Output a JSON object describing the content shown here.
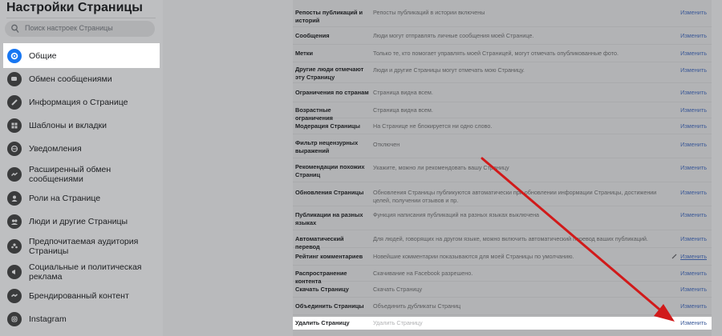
{
  "sidebar": {
    "title": "Настройки Страницы",
    "search_placeholder": "Поиск настроек Страницы",
    "items": [
      {
        "label": "Общие",
        "icon": "gear-icon"
      },
      {
        "label": "Обмен сообщениями",
        "icon": "chat-bubble-icon"
      },
      {
        "label": "Информация о Странице",
        "icon": "pencil-icon"
      },
      {
        "label": "Шаблоны и вкладки",
        "icon": "grid-icon"
      },
      {
        "label": "Уведомления",
        "icon": "globe-icon"
      },
      {
        "label": "Расширенный обмен сообщениями",
        "icon": "messenger-icon"
      },
      {
        "label": "Роли на Странице",
        "icon": "person-icon"
      },
      {
        "label": "Люди и другие Страницы",
        "icon": "people-icon"
      },
      {
        "label": "Предпочитаемая аудитория Страницы",
        "icon": "audience-icon"
      },
      {
        "label": "Социальные и политическая реклама",
        "icon": "megaphone-icon"
      },
      {
        "label": "Брендированный контент",
        "icon": "handshake-icon"
      },
      {
        "label": "Instagram",
        "icon": "instagram-icon"
      }
    ]
  },
  "settings": {
    "rows": [
      {
        "name": "Репосты публикаций и историй",
        "desc": "Репосты публикаций в истории включены",
        "edit": "Изменить"
      },
      {
        "name": "Сообщения",
        "desc": "Люди могут отправлять личные сообщения моей Странице.",
        "edit": "Изменить"
      },
      {
        "name": "Метки",
        "desc": "Только те, кто помогает управлять моей Страницей, могут отмечать опубликованные фото.",
        "edit": "Изменить"
      },
      {
        "name": "Другие люди отмечают эту Страницу",
        "desc": "Люди и другие Страницы могут отмечать мою Страницу.",
        "edit": "Изменить"
      },
      {
        "name": "Ограничения по странам",
        "desc": "Страница видна всем.",
        "edit": "Изменить"
      },
      {
        "name": "Возрастные ограничения",
        "desc": "Страница видна всем.",
        "edit": "Изменить"
      },
      {
        "name": "Модерация Страницы",
        "desc": "На Странице не блокируется ни одно слово.",
        "edit": "Изменить"
      },
      {
        "name": "Фильтр нецензурных выражений",
        "desc": "Отключен",
        "edit": "Изменить"
      },
      {
        "name": "Рекомендации похожих Страниц",
        "desc": "Укажите, можно ли рекомендовать вашу Страницу",
        "edit": "Изменить"
      },
      {
        "name": "Обновления Страницы",
        "desc": "Обновления Страницы публикуются автоматически при обновлении информации Страницы, достижении целей, получении отзывов и пр.",
        "edit": "Изменить"
      },
      {
        "name": "Публикации на разных языках",
        "desc": "Функция написания публикаций на разных языках выключена",
        "edit": "Изменить"
      },
      {
        "name": "Автоматический перевод",
        "desc": "Для людей, говорящих на другом языке, можно включить автоматический перевод ваших публикаций.",
        "edit": "Изменить"
      },
      {
        "name": "Рейтинг комментариев",
        "desc": "Новейшие комментарии показываются для моей Страницы по умолчанию.",
        "edit": "Изменить"
      },
      {
        "name": "Распространение контента",
        "desc": "Скачивание на Facebook разрешено.",
        "edit": "Изменить"
      },
      {
        "name": "Скачать Страницу",
        "desc": "Скачать Страницу",
        "edit": "Изменить"
      },
      {
        "name": "Объединить Страницы",
        "desc": "Объединить дубликаты Страниц",
        "edit": "Изменить"
      },
      {
        "name": "Удалить Страницу",
        "desc": "Удалить Страницу",
        "edit": "Изменить"
      }
    ]
  },
  "colors": {
    "accent": "#1877f2",
    "link": "#3b5998",
    "arrow": "#d11a1a"
  }
}
